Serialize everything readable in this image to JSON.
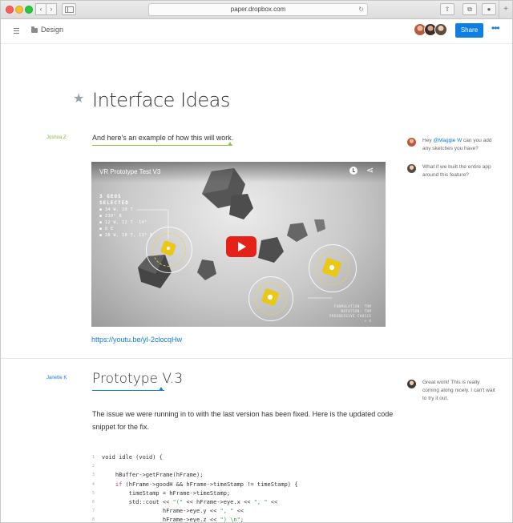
{
  "browser": {
    "url": "paper.dropbox.com",
    "back_glyph": "‹",
    "forward_glyph": "›",
    "reload_glyph": "↻",
    "share_glyph": "⇧",
    "tabs_glyph": "⧉",
    "download_glyph": "●",
    "new_tab_glyph": "+"
  },
  "header": {
    "breadcrumb": "Design",
    "share_label": "Share",
    "more_glyph": "•••"
  },
  "doc": {
    "star_glyph": "★",
    "title": "Interface Ideas",
    "author_1": "Joshua Z",
    "para_1": "And here's an example of how this will work.",
    "video": {
      "title": "VR Prototype Test V3",
      "share_glyph": "⋖",
      "stats_heading_1": "3 GEOS",
      "stats_heading_2": "SELECTED",
      "stats": [
        "● 34 W, 20 T",
        "● 230° R",
        "● 12 W, 12 T -14°",
        "● 8 E",
        "● 28 W, 10 T, 11° R"
      ],
      "legend": [
        "FORMULATION: TRM",
        "NOTATION: TRM",
        "PROGRESSIVE CHOICE",
        "+ 4"
      ]
    },
    "video_link": "https://youtu.be/yI-2clocqHw",
    "author_2": "Janette K",
    "section_title": "Prototype V.3",
    "para_2": "The issue we were running in to with the last version has been fixed. Here is the updated code snippet for the fix.",
    "code": [
      {
        "n": "1",
        "parts": [
          [
            "t",
            "void idle (void) {"
          ]
        ]
      },
      {
        "n": "2",
        "parts": [
          [
            "t",
            ""
          ]
        ]
      },
      {
        "n": "3",
        "parts": [
          [
            "t",
            "    hBuffer->getFrame(hFrame);"
          ]
        ]
      },
      {
        "n": "4",
        "parts": [
          [
            "t",
            "    "
          ],
          [
            "k",
            "if"
          ],
          [
            "t",
            " (hFrame->goodH && hFrame->timeStamp != timeStamp) {"
          ]
        ]
      },
      {
        "n": "5",
        "parts": [
          [
            "t",
            "        timeStamp = hFrame->timeStamp;"
          ]
        ]
      },
      {
        "n": "6",
        "parts": [
          [
            "t",
            "        std::cout << "
          ],
          [
            "s",
            "\"(\""
          ],
          [
            "t",
            " << hFrame->eye.x << "
          ],
          [
            "s",
            "\", \""
          ],
          [
            "t",
            " <<"
          ]
        ]
      },
      {
        "n": "7",
        "parts": [
          [
            "t",
            "                  hFrame->eye.y << "
          ],
          [
            "s",
            "\", \""
          ],
          [
            "t",
            " <<"
          ]
        ]
      },
      {
        "n": "8",
        "parts": [
          [
            "t",
            "                  hFrame->eye.z << "
          ],
          [
            "s",
            "\") \\n\""
          ],
          [
            "t",
            ";"
          ]
        ]
      }
    ]
  },
  "comments": [
    {
      "before": "Hey ",
      "mention": "@Maggie W",
      "after": " can you add any sketches you have?"
    },
    {
      "before": "What if we built the entire app around this feature?",
      "mention": "",
      "after": ""
    },
    {
      "before": "Great work! This is really coming along nicely. I can't wait to try it out.",
      "mention": "",
      "after": ""
    }
  ],
  "colors": {
    "accent_blue": "#0d7ee4",
    "author_green": "#7fb83c",
    "youtube_red": "#e62117",
    "gem_yellow": "#e9c81a"
  }
}
